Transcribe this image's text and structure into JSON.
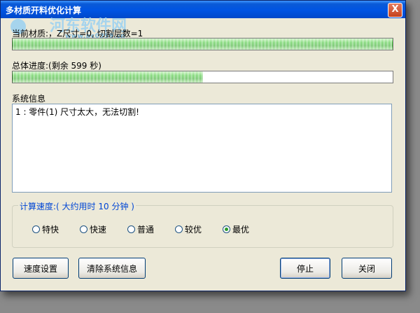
{
  "window": {
    "title": "多材质开料优化计算",
    "close_label": "X"
  },
  "current_material": {
    "label": "当前材质:，Z尺寸=0, 切割层数=1",
    "progress_fraction": 1.0
  },
  "overall": {
    "label": "总体进度:(剩余 599 秒)",
    "progress_fraction": 0.5
  },
  "system_info": {
    "label": "系统信息",
    "lines": [
      "1 : 零件(1) 尺寸太大，无法切割!"
    ]
  },
  "speed_group": {
    "title": "计算速度:( 大约用时 10 分钟 )",
    "options": [
      {
        "label": "特快",
        "checked": false
      },
      {
        "label": "快速",
        "checked": false
      },
      {
        "label": "普通",
        "checked": false
      },
      {
        "label": "较优",
        "checked": false
      },
      {
        "label": "最优",
        "checked": true
      }
    ]
  },
  "buttons": {
    "speed_settings": "速度设置",
    "clear_info": "清除系统信息",
    "stop": "停止",
    "close": "关闭"
  },
  "watermark": {
    "text": "河东软件网",
    "url": "www.pc0359.cn"
  },
  "colors": {
    "titlebar": "#0054e3",
    "progress_fill": "#2aa61e",
    "group_title": "#0046d5"
  }
}
